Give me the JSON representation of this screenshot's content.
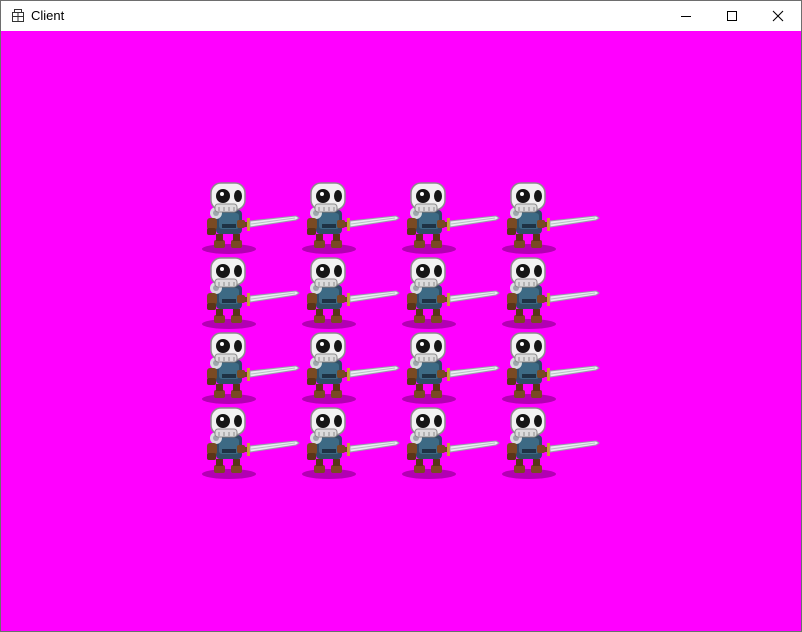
{
  "window": {
    "title": "Client",
    "icon": "app-window-icon",
    "controls": [
      "minimize-icon",
      "maximize-icon",
      "close-icon"
    ]
  },
  "client_area": {
    "background_color": "#ff00ff",
    "sprite": "skeleton-warrior-sword",
    "grid": {
      "rows": 4,
      "columns": 4
    }
  }
}
